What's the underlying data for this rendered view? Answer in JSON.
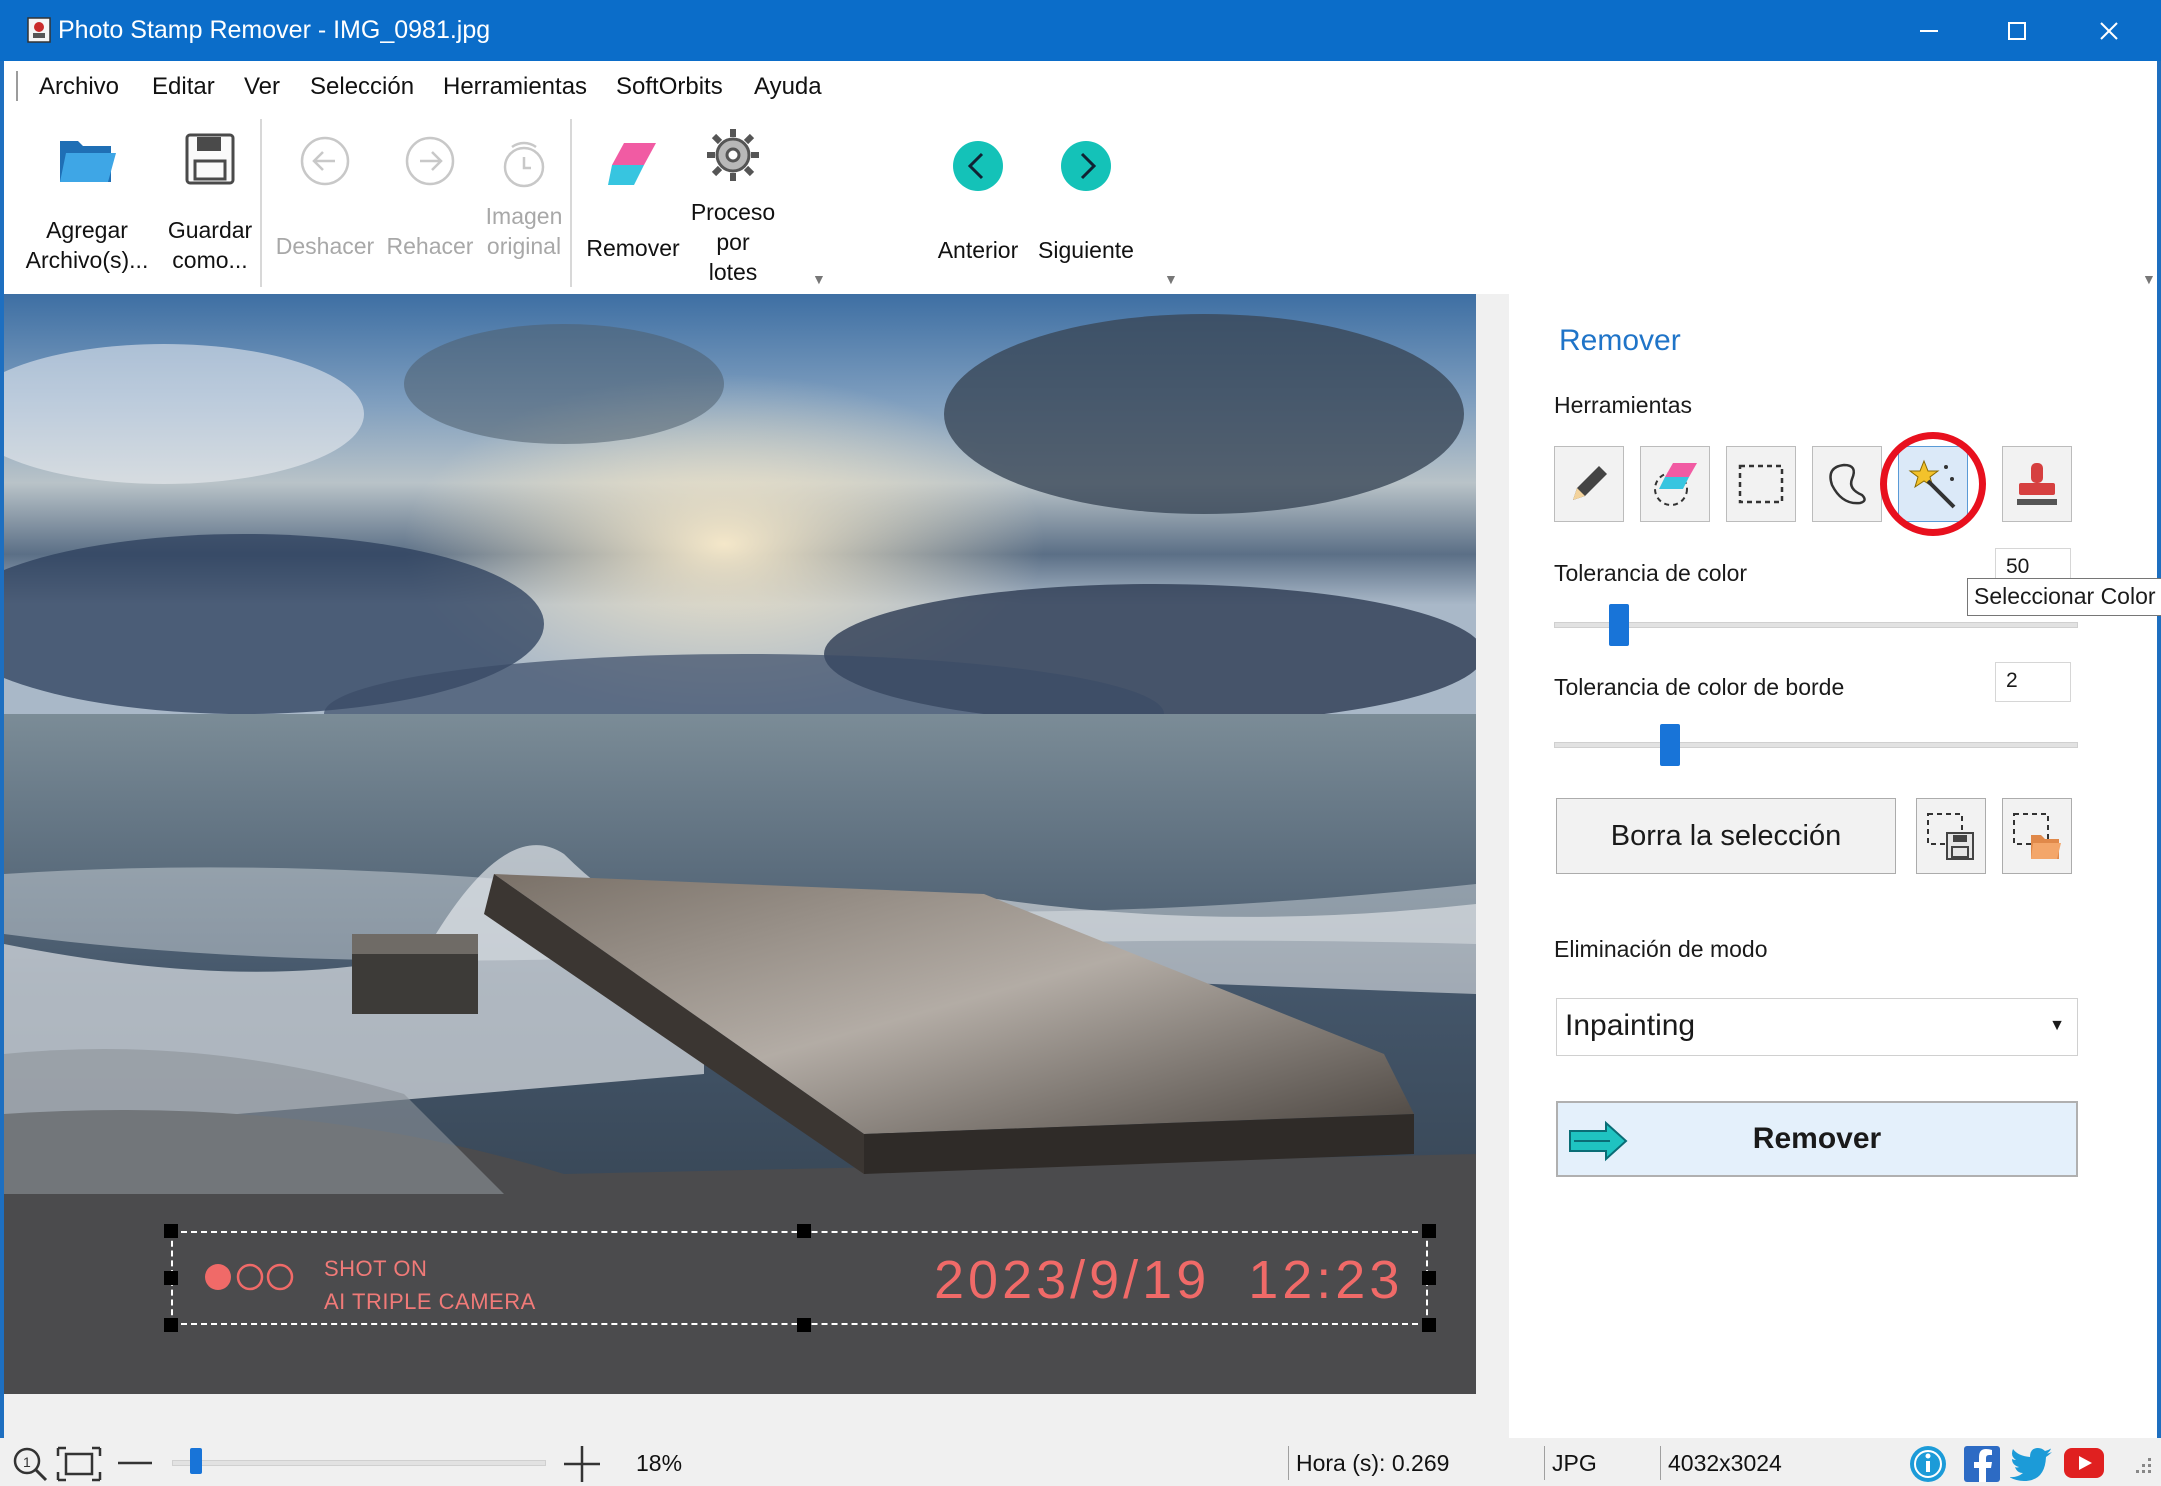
{
  "window": {
    "title": "Photo Stamp Remover - IMG_0981.jpg",
    "controls": {
      "minimize": "—",
      "maximize": "☐",
      "close": "✕"
    }
  },
  "menu": {
    "items": [
      "Archivo",
      "Editar",
      "Ver",
      "Selección",
      "Herramientas",
      "SoftOrbits",
      "Ayuda"
    ]
  },
  "toolbar": {
    "add_files": [
      "Agregar",
      "Archivo(s)..."
    ],
    "save_as": [
      "Guardar",
      "como..."
    ],
    "undo": "Deshacer",
    "redo": "Rehacer",
    "original": [
      "Imagen",
      "original"
    ],
    "remove": "Remover",
    "batch": [
      "Proceso",
      "por",
      "lotes"
    ],
    "previous": "Anterior",
    "next": "Siguiente"
  },
  "image": {
    "stamp_left": [
      "SHOT ON",
      "AI TRIPLE CAMERA"
    ],
    "stamp_date": "2023/9/19  12:23"
  },
  "panel": {
    "title": "Remover",
    "tools_label": "Herramientas",
    "tools": [
      "pencil-icon",
      "eraser-icon",
      "rect-select-icon",
      "lasso-icon",
      "magic-wand-icon",
      "stamp-icon"
    ],
    "active_tool": "magic-wand-icon",
    "color_tolerance": {
      "label": "Tolerancia de color",
      "value": "50",
      "fraction": 0.11
    },
    "tooltip": "Seleccionar Color",
    "edge_tolerance": {
      "label": "Tolerancia de color de borde",
      "value": "2",
      "fraction": 0.21
    },
    "clear_selection": "Borra la selección",
    "mode_label": "Eliminación de modo",
    "mode_value": "Inpainting",
    "remove_button": "Remover"
  },
  "status": {
    "zoom": "18%",
    "zoom_fraction": 0.05,
    "time": "Hora (s): 0.269",
    "format": "JPG",
    "dimensions": "4032x3024"
  },
  "colors": {
    "titlebar": "#0b6dc9",
    "accent": "#1874d8",
    "highlight_ring": "#e8101e",
    "stamp_text": "#f06a68"
  }
}
